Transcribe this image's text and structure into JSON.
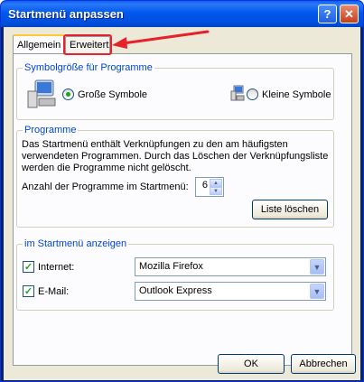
{
  "window": {
    "title": "Startmenü anpassen"
  },
  "titlebar": {
    "help_label": "?",
    "close_label": "✕"
  },
  "tabs": [
    {
      "label": "Allgemein",
      "active": true
    },
    {
      "label": "Erweitert",
      "active": false
    }
  ],
  "group_icon_size": {
    "title": "Symbolgröße für Programme",
    "large_label": "Große Symbole",
    "small_label": "Kleine Symbole",
    "selected": "large"
  },
  "group_programs": {
    "title": "Programme",
    "description_lines": [
      "Das Startmenü enthält Verknüpfungen zu den am häufigsten",
      "verwendeten Programmen. Durch das Löschen der Verknüpfungsliste",
      "werden die Programme nicht gelöscht."
    ],
    "count_label": "Anzahl der Programme im Startmenü:",
    "count_value": "6",
    "clear_button": "Liste löschen"
  },
  "group_startmenu": {
    "title": "im Startmenü anzeigen",
    "internet_label": "Internet:",
    "internet_checked": true,
    "internet_value": "Mozilla Firefox",
    "email_label": "E-Mail:",
    "email_checked": true,
    "email_value": "Outlook Express"
  },
  "footer": {
    "ok": "OK",
    "cancel": "Abbrechen"
  },
  "colors": {
    "titlebar": "#0058ee",
    "group_title": "#0046d5",
    "highlight": "#e8202a",
    "check": "#21a121"
  },
  "icons": [
    "help-icon",
    "close-icon",
    "large-icons-icon",
    "small-icons-icon",
    "spin-up-icon",
    "spin-down-icon",
    "dropdown-arrow-icon",
    "annotation-arrow-icon"
  ]
}
